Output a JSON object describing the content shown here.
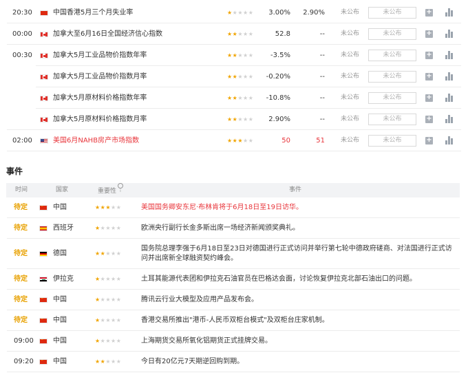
{
  "indicators": [
    {
      "time": "20:30",
      "flag": "hk",
      "name": "中国香港5月三个月失业率",
      "stars": 1,
      "previous": "3.00%",
      "forecast": "2.90%",
      "actual": "未公布",
      "box": "未公布",
      "highlight": false
    },
    {
      "time": "00:00",
      "flag": "ca",
      "name": "加拿大至6月16日全国经济信心指数",
      "stars": 2,
      "previous": "52.8",
      "forecast": "--",
      "actual": "未公布",
      "box": "未公布",
      "highlight": false
    },
    {
      "time": "00:30",
      "flag": "ca",
      "name": "加拿大5月工业品物价指数年率",
      "stars": 2,
      "previous": "-3.5%",
      "forecast": "--",
      "actual": "未公布",
      "box": "未公布",
      "highlight": false
    },
    {
      "time": "",
      "flag": "ca",
      "name": "加拿大5月工业品物价指数月率",
      "stars": 2,
      "previous": "-0.20%",
      "forecast": "--",
      "actual": "未公布",
      "box": "未公布",
      "highlight": false
    },
    {
      "time": "",
      "flag": "ca",
      "name": "加拿大5月原材料价格指数年率",
      "stars": 2,
      "previous": "-10.8%",
      "forecast": "--",
      "actual": "未公布",
      "box": "未公布",
      "highlight": false
    },
    {
      "time": "",
      "flag": "ca",
      "name": "加拿大5月原材料价格指数月率",
      "stars": 2,
      "previous": "2.90%",
      "forecast": "--",
      "actual": "未公布",
      "box": "未公布",
      "highlight": false
    },
    {
      "time": "02:00",
      "flag": "us",
      "name": "美国6月NAHB房产市场指数",
      "stars": 3,
      "previous": "50",
      "forecast": "51",
      "actual": "未公布",
      "box": "未公布",
      "highlight": true
    }
  ],
  "events_section": {
    "title": "事件",
    "headers": {
      "time": "时间",
      "country": "国家",
      "importance": "重要性",
      "event": "事件"
    }
  },
  "events": [
    {
      "status": "待定",
      "flag": "cn",
      "country": "中国",
      "stars": 3,
      "text": "美国国务卿安东尼·布林肯将于6月18日至19日访华。",
      "highlight": true
    },
    {
      "status": "待定",
      "flag": "es",
      "country": "西班牙",
      "stars": 1,
      "text": "欧洲央行副行长金多斯出席一场经济新闻颁奖典礼。",
      "highlight": false
    },
    {
      "status": "待定",
      "flag": "de",
      "country": "德国",
      "stars": 2,
      "text": "国务院总理李强于6月18日至23日对德国进行正式访问并举行第七轮中德政府磋商、对法国进行正式访问并出席新全球融资契约峰会。",
      "highlight": false
    },
    {
      "status": "待定",
      "flag": "iq",
      "country": "伊拉克",
      "stars": 1,
      "text": "土耳其能源代表团和伊拉克石油官员在巴格达会面，讨论恢复伊拉克北部石油出口的问题。",
      "highlight": false
    },
    {
      "status": "待定",
      "flag": "cn",
      "country": "中国",
      "stars": 1,
      "text": "腾讯云行业大模型及应用产品发布会。",
      "highlight": false
    },
    {
      "status": "待定",
      "flag": "cn",
      "country": "中国",
      "stars": 1,
      "text": "香港交易所推出\"港币-人民币双柜台模式\"及双柜台庄家机制。",
      "highlight": false
    },
    {
      "status": "09:00",
      "flag": "cn",
      "country": "中国",
      "stars": 1,
      "text": "上海期货交易所氧化铝期货正式挂牌交易。",
      "highlight": false
    },
    {
      "status": "09:20",
      "flag": "cn",
      "country": "中国",
      "stars": 2,
      "text": "今日有20亿元7天期逆回购到期。",
      "highlight": false
    }
  ],
  "colors": {
    "accent_red": "#e8343a",
    "pending_orange": "#e8a100",
    "star_on": "#f0a400",
    "star_off": "#d0d0d0"
  }
}
